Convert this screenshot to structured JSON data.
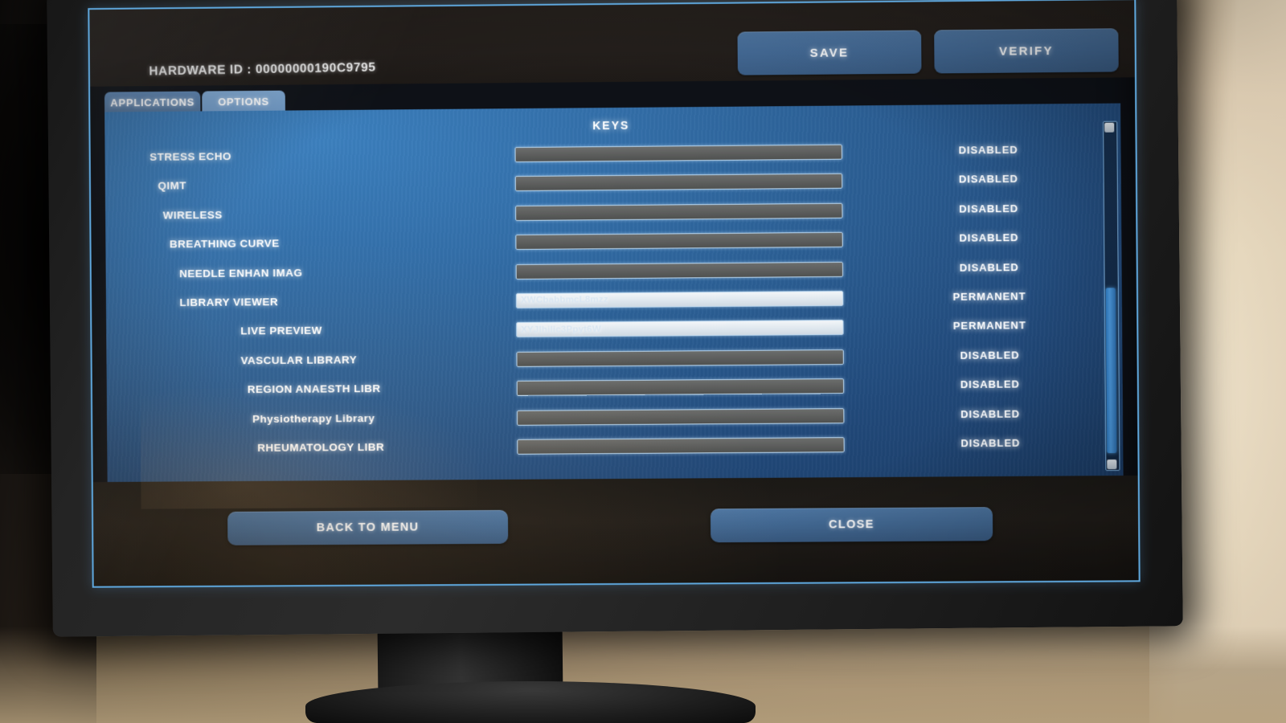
{
  "header": {
    "hardware_id_label": "HARDWARE ID : 00000000190C9795",
    "save_label": "SAVE",
    "verify_label": "VERIFY"
  },
  "tabs": [
    {
      "label": "APPLICATIONS",
      "active": false
    },
    {
      "label": "OPTIONS",
      "active": true
    }
  ],
  "panel": {
    "title": "KEYS",
    "rows": [
      {
        "label": "STRESS ECHO",
        "indent": 0,
        "key": "",
        "key_state": "disabled",
        "status": "DISABLED"
      },
      {
        "label": "QIMT",
        "indent": 1,
        "key": "",
        "key_state": "disabled",
        "status": "DISABLED"
      },
      {
        "label": "WIRELESS",
        "indent": 2,
        "key": "",
        "key_state": "disabled",
        "status": "DISABLED"
      },
      {
        "label": "BREATHING CURVE",
        "indent": 3,
        "key": "",
        "key_state": "disabled",
        "status": "DISABLED"
      },
      {
        "label": "NEEDLE ENHAN IMAG",
        "indent": 4,
        "key": "",
        "key_state": "disabled",
        "status": "DISABLED"
      },
      {
        "label": "LIBRARY VIEWER",
        "indent": 4,
        "key": "XWCbabbmcL8mzz",
        "key_state": "enabled",
        "status": "PERMANENT"
      },
      {
        "label": "LIVE PREVIEW",
        "indent": 5,
        "key": "XYJlhilic3Ppyt6W",
        "key_state": "enabled",
        "status": "PERMANENT"
      },
      {
        "label": "VASCULAR LIBRARY",
        "indent": 5,
        "key": "",
        "key_state": "disabled",
        "status": "DISABLED"
      },
      {
        "label": "REGION ANAESTH LIBR",
        "indent": 6,
        "key": "",
        "key_state": "disabled",
        "status": "DISABLED"
      },
      {
        "label": "Physiotherapy Library",
        "indent": 7,
        "key": "",
        "key_state": "disabled",
        "status": "DISABLED"
      },
      {
        "label": "RHEUMATOLOGY LIBR",
        "indent": 8,
        "key": "",
        "key_state": "disabled",
        "status": "DISABLED"
      }
    ],
    "scrollbar": {
      "up_icon": "scroll-up-arrow",
      "down_icon": "scroll-down-arrow"
    }
  },
  "footer": {
    "back_label": "BACK TO MENU",
    "close_label": "CLOSE"
  },
  "colors": {
    "panel_blue": "#336fa9",
    "accent_border": "#5fa8de",
    "button_blue": "#446a96",
    "thumb_blue": "#4d9ade",
    "text_white": "#ffffff"
  }
}
